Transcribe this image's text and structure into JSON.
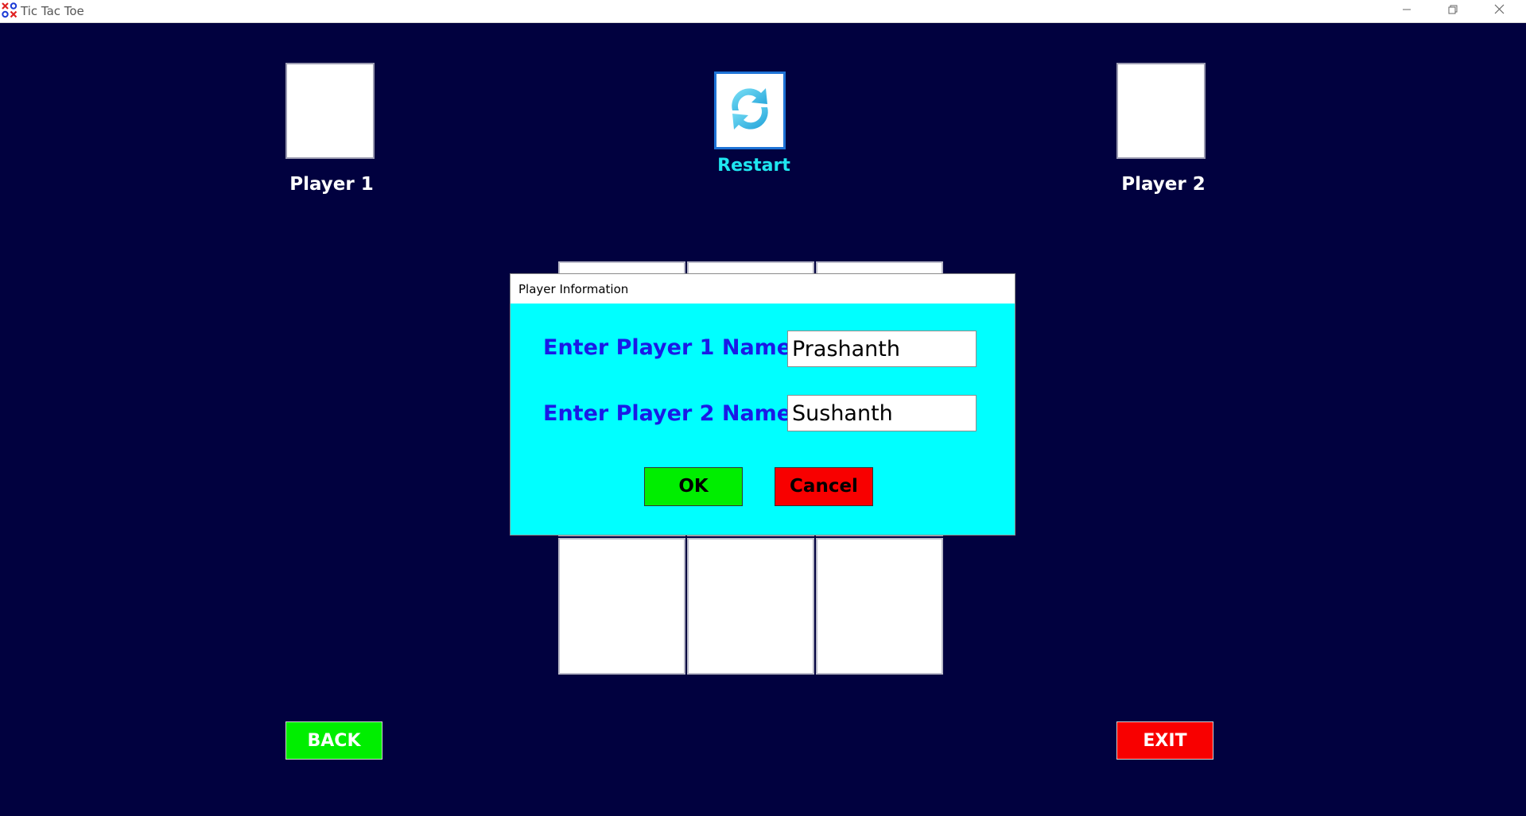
{
  "window": {
    "title": "Tic Tac Toe"
  },
  "header": {
    "player1_label": "Player 1",
    "player2_label": "Player 2",
    "restart_label": "Restart"
  },
  "footer": {
    "back_label": "BACK",
    "exit_label": "EXIT"
  },
  "dialog": {
    "title": "Player Information",
    "player1_prompt": "Enter Player 1 Name",
    "player2_prompt": "Enter Player 2 Name",
    "player1_value": "Prashanth",
    "player2_value": "Sushanth",
    "ok_label": "OK",
    "cancel_label": "Cancel"
  },
  "colors": {
    "background": "#01013f",
    "dialog_background": "#00ffff",
    "ok_button": "#00ee00",
    "cancel_button": "#f80000",
    "label_blue": "#1a1ae6",
    "restart_cyan": "#1fe6f0"
  }
}
